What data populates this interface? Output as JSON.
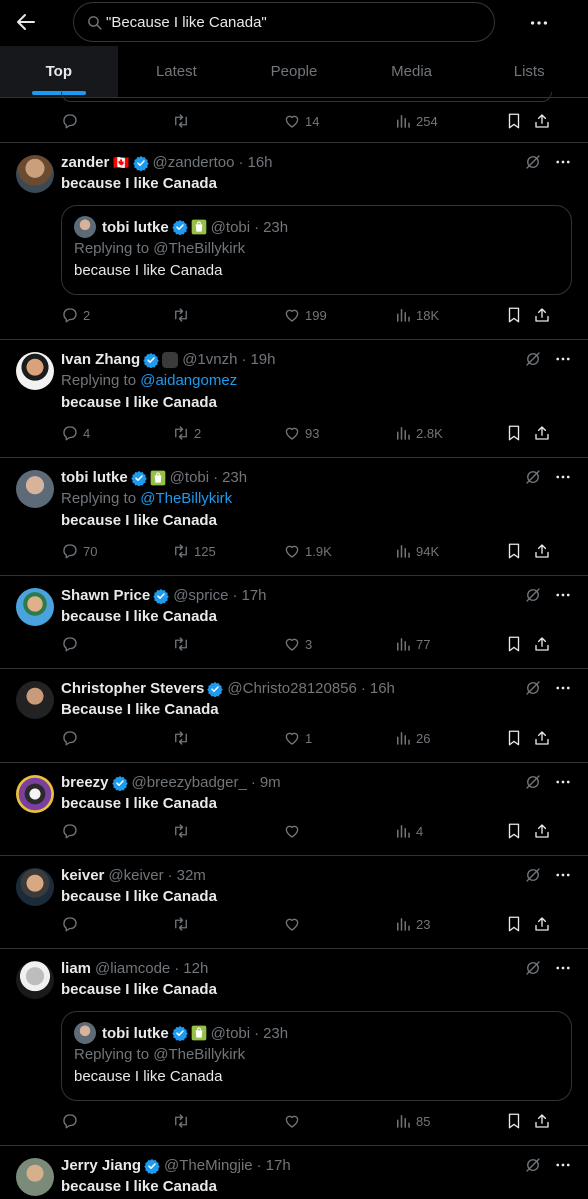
{
  "search": {
    "query": "\"Because I like Canada\""
  },
  "tabs": [
    "Top",
    "Latest",
    "People",
    "Media",
    "Lists"
  ],
  "partial_tweet": {
    "likes": "14",
    "views": "254"
  },
  "tweets": [
    {
      "name": "zander",
      "flag": "🇨🇦",
      "handle": "@zandertoo",
      "time": "16h",
      "text": "because I like Canada",
      "quote": {
        "name": "tobi lutke",
        "handle": "@tobi",
        "time": "23h",
        "reply_label": "Replying to",
        "reply_to": "@TheBillykirk",
        "text": "because I like Canada"
      },
      "stats": {
        "replies": "2",
        "reposts": "",
        "likes": "199",
        "views": "18K"
      }
    },
    {
      "name": "Ivan Zhang",
      "handle": "@1vnzh",
      "time": "19h",
      "reply_label": "Replying to",
      "reply_to": "@aidangomez",
      "text": "because I like Canada",
      "stats": {
        "replies": "4",
        "reposts": "2",
        "likes": "93",
        "views": "2.8K"
      }
    },
    {
      "name": "tobi lutke",
      "handle": "@tobi",
      "time": "23h",
      "reply_label": "Replying to",
      "reply_to": "@TheBillykirk",
      "text": "because I like Canada",
      "stats": {
        "replies": "70",
        "reposts": "125",
        "likes": "1.9K",
        "views": "94K"
      }
    },
    {
      "name": "Shawn Price",
      "handle": "@sprice",
      "time": "17h",
      "text": "because I like Canada",
      "stats": {
        "replies": "",
        "reposts": "",
        "likes": "3",
        "views": "77"
      }
    },
    {
      "name": "Christopher Stevers",
      "handle": "@Christo28120856",
      "time": "16h",
      "text": "Because I like Canada",
      "stats": {
        "replies": "",
        "reposts": "",
        "likes": "1",
        "views": "26"
      }
    },
    {
      "name": "breezy",
      "handle": "@breezybadger_",
      "time": "9m",
      "text": "because I like Canada",
      "stats": {
        "replies": "",
        "reposts": "",
        "likes": "",
        "views": "4"
      }
    },
    {
      "name": "keiver",
      "handle": "@keiver",
      "time": "32m",
      "text": "because I like Canada",
      "stats": {
        "replies": "",
        "reposts": "",
        "likes": "",
        "views": "23"
      }
    },
    {
      "name": "liam",
      "handle": "@liamcode",
      "time": "12h",
      "text": "because I like Canada",
      "quote": {
        "name": "tobi lutke",
        "handle": "@tobi",
        "time": "23h",
        "reply_label": "Replying to",
        "reply_to": "@TheBillykirk",
        "text": "because I like Canada"
      },
      "stats": {
        "replies": "",
        "reposts": "",
        "likes": "",
        "views": "85"
      }
    },
    {
      "name": "Jerry Jiang",
      "handle": "@TheMingjie",
      "time": "17h",
      "text": "because I like Canada"
    }
  ],
  "colors": {
    "accent": "#1d9bf0",
    "verified": "#1d9bf0",
    "muted": "#71767b",
    "background": "#000000",
    "border": "#2f3336"
  },
  "icons": {
    "back": "arrow-left-icon",
    "search": "search-icon",
    "more": "more-horizontal-icon",
    "grok": "grok-icon",
    "reply": "reply-icon",
    "repost": "repost-icon",
    "like": "heart-icon",
    "views": "views-icon",
    "bookmark": "bookmark-icon",
    "share": "share-icon",
    "verified": "verified-badge-icon",
    "affiliate": "shopify-affiliate-icon"
  }
}
